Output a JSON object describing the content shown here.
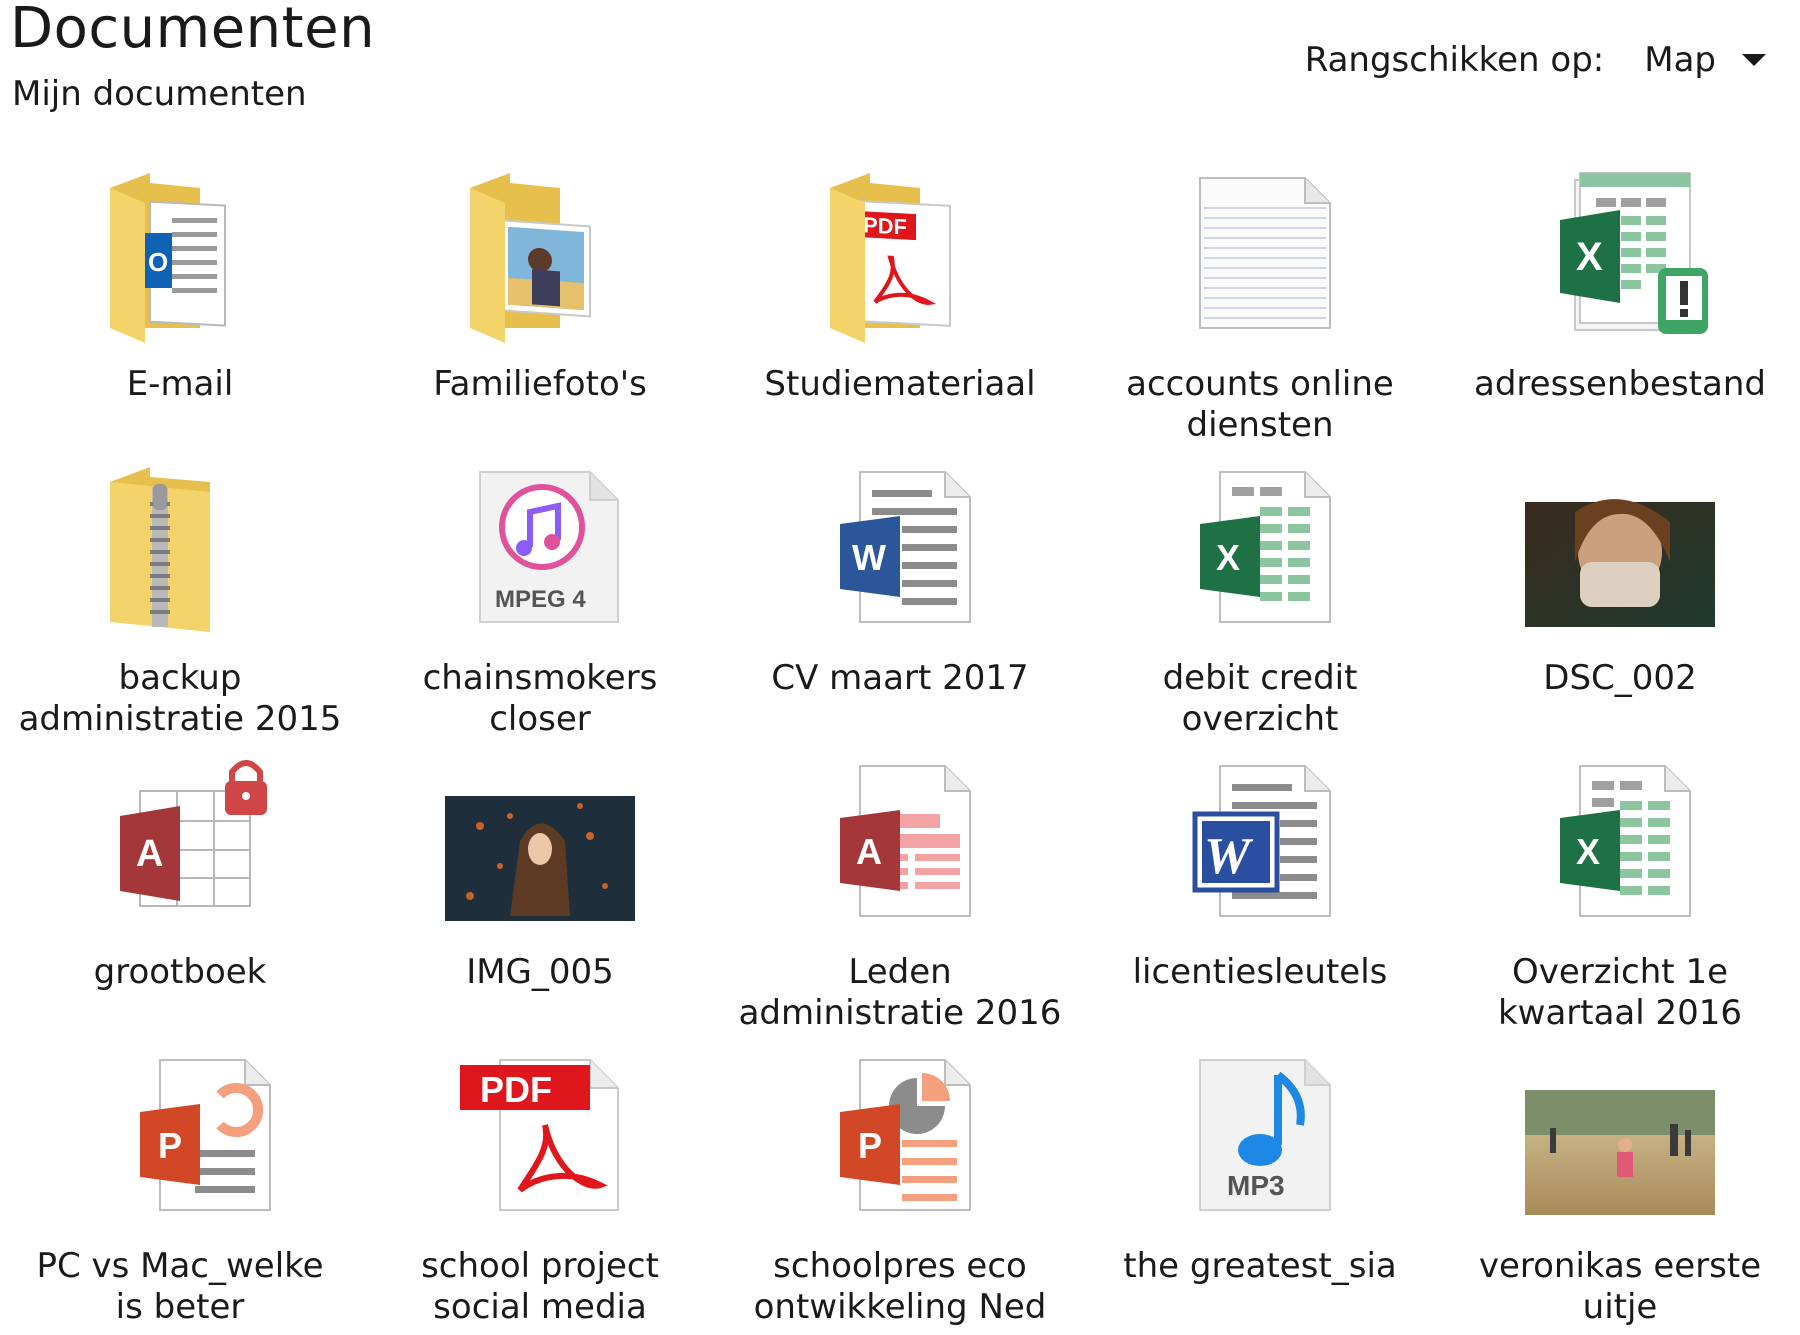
{
  "header": {
    "title": "Documenten",
    "subtitle": "Mijn documenten",
    "sort_label": "Rangschikken op:",
    "sort_value": "Map"
  },
  "items": [
    {
      "name": "E-mail",
      "icon": "folder-outlook-icon"
    },
    {
      "name": "Familiefoto's",
      "icon": "folder-photo-icon"
    },
    {
      "name": "Studiemateriaal",
      "icon": "folder-pdf-icon"
    },
    {
      "name": "accounts online\ndiensten",
      "icon": "text-document-icon"
    },
    {
      "name": "adressenbestand",
      "icon": "excel-warning-icon"
    },
    {
      "name": "backup\nadministratie 2015",
      "icon": "zip-folder-icon"
    },
    {
      "name": "chainsmokers\ncloser",
      "icon": "mpeg4-music-icon"
    },
    {
      "name": "CV maart 2017",
      "icon": "word-document-icon"
    },
    {
      "name": "debit credit\noverzicht",
      "icon": "excel-document-icon"
    },
    {
      "name": "DSC_002",
      "icon": "photo-thumbnail-icon"
    },
    {
      "name": "grootboek",
      "icon": "access-locked-icon"
    },
    {
      "name": "IMG_005",
      "icon": "photo-thumbnail-icon"
    },
    {
      "name": "Leden\nadministratie 2016",
      "icon": "access-document-icon"
    },
    {
      "name": "licentiesleutels",
      "icon": "wordpad-document-icon"
    },
    {
      "name": "Overzicht 1e\nkwartaal 2016",
      "icon": "excel-document-icon"
    },
    {
      "name": "PC vs Mac_welke\nis beter",
      "icon": "powerpoint-document-icon"
    },
    {
      "name": "school project\nsocial media",
      "icon": "pdf-document-icon"
    },
    {
      "name": "schoolpres eco\nontwikkeling Ned",
      "icon": "powerpoint-document-icon"
    },
    {
      "name": "the greatest_sia",
      "icon": "mp3-music-icon"
    },
    {
      "name": "veronikas eerste\nuitje",
      "icon": "photo-thumbnail-icon"
    }
  ],
  "icon_text": {
    "pdf": "PDF",
    "excel": "X",
    "word": "W",
    "access": "A",
    "powerpoint": "P",
    "outlook": "O",
    "mpeg4": "MPEG 4",
    "mp3": "MP3"
  },
  "colors": {
    "folder": "#f4d46a",
    "excel": "#1e7145",
    "word": "#2b579a",
    "access": "#a4373a",
    "powerpoint": "#d24726",
    "pdf": "#e0161d",
    "outlook": "#0f62b3"
  }
}
